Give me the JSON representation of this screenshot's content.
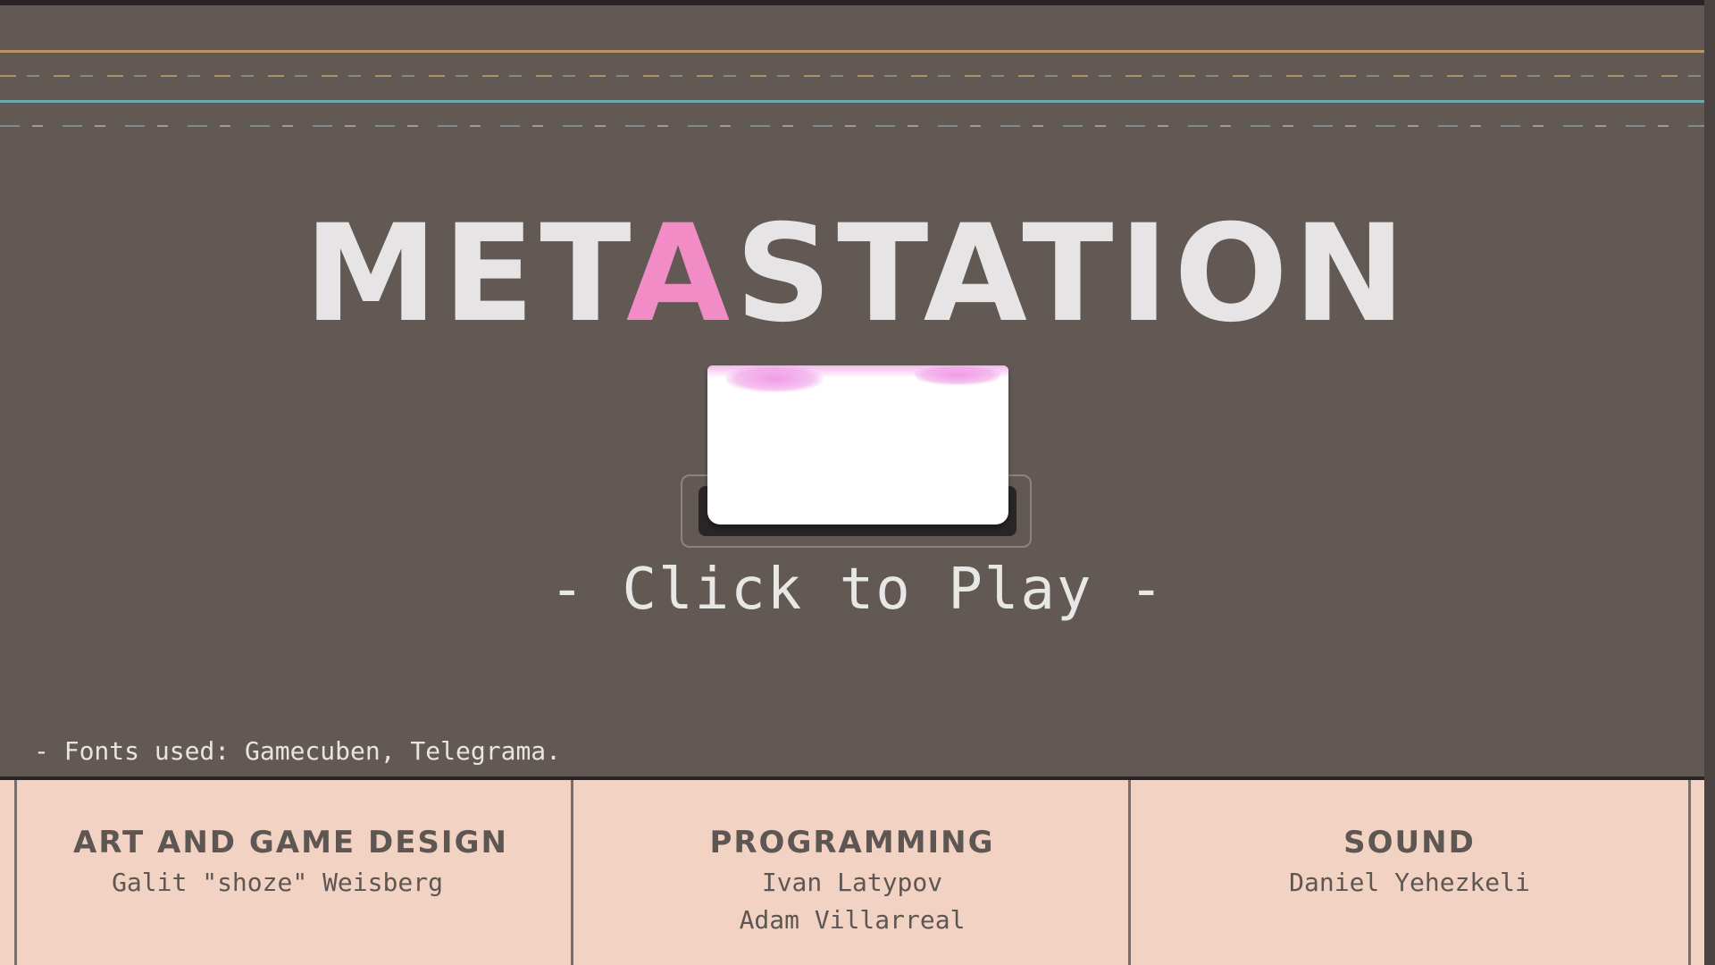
{
  "title": {
    "before": "MET",
    "accent": "A",
    "after": "STATION"
  },
  "play_button": {
    "cta": "- Click to Play -"
  },
  "fonts_note": "- Fonts used: Gamecuben, Telegrama.",
  "credits": [
    {
      "role": "ART AND GAME DESIGN",
      "names": [
        "Galit \"shoze\" Weisberg"
      ]
    },
    {
      "role": "PROGRAMMING",
      "names": [
        "Ivan Latypov",
        "Adam Villarreal"
      ]
    },
    {
      "role": "SOUND",
      "names": [
        "Daniel Yehezkeli"
      ]
    }
  ],
  "colors": {
    "background": "#625955",
    "title": "#e6e4e4",
    "accent": "#f28cc7",
    "credits_panel": "#f2d3c3"
  }
}
